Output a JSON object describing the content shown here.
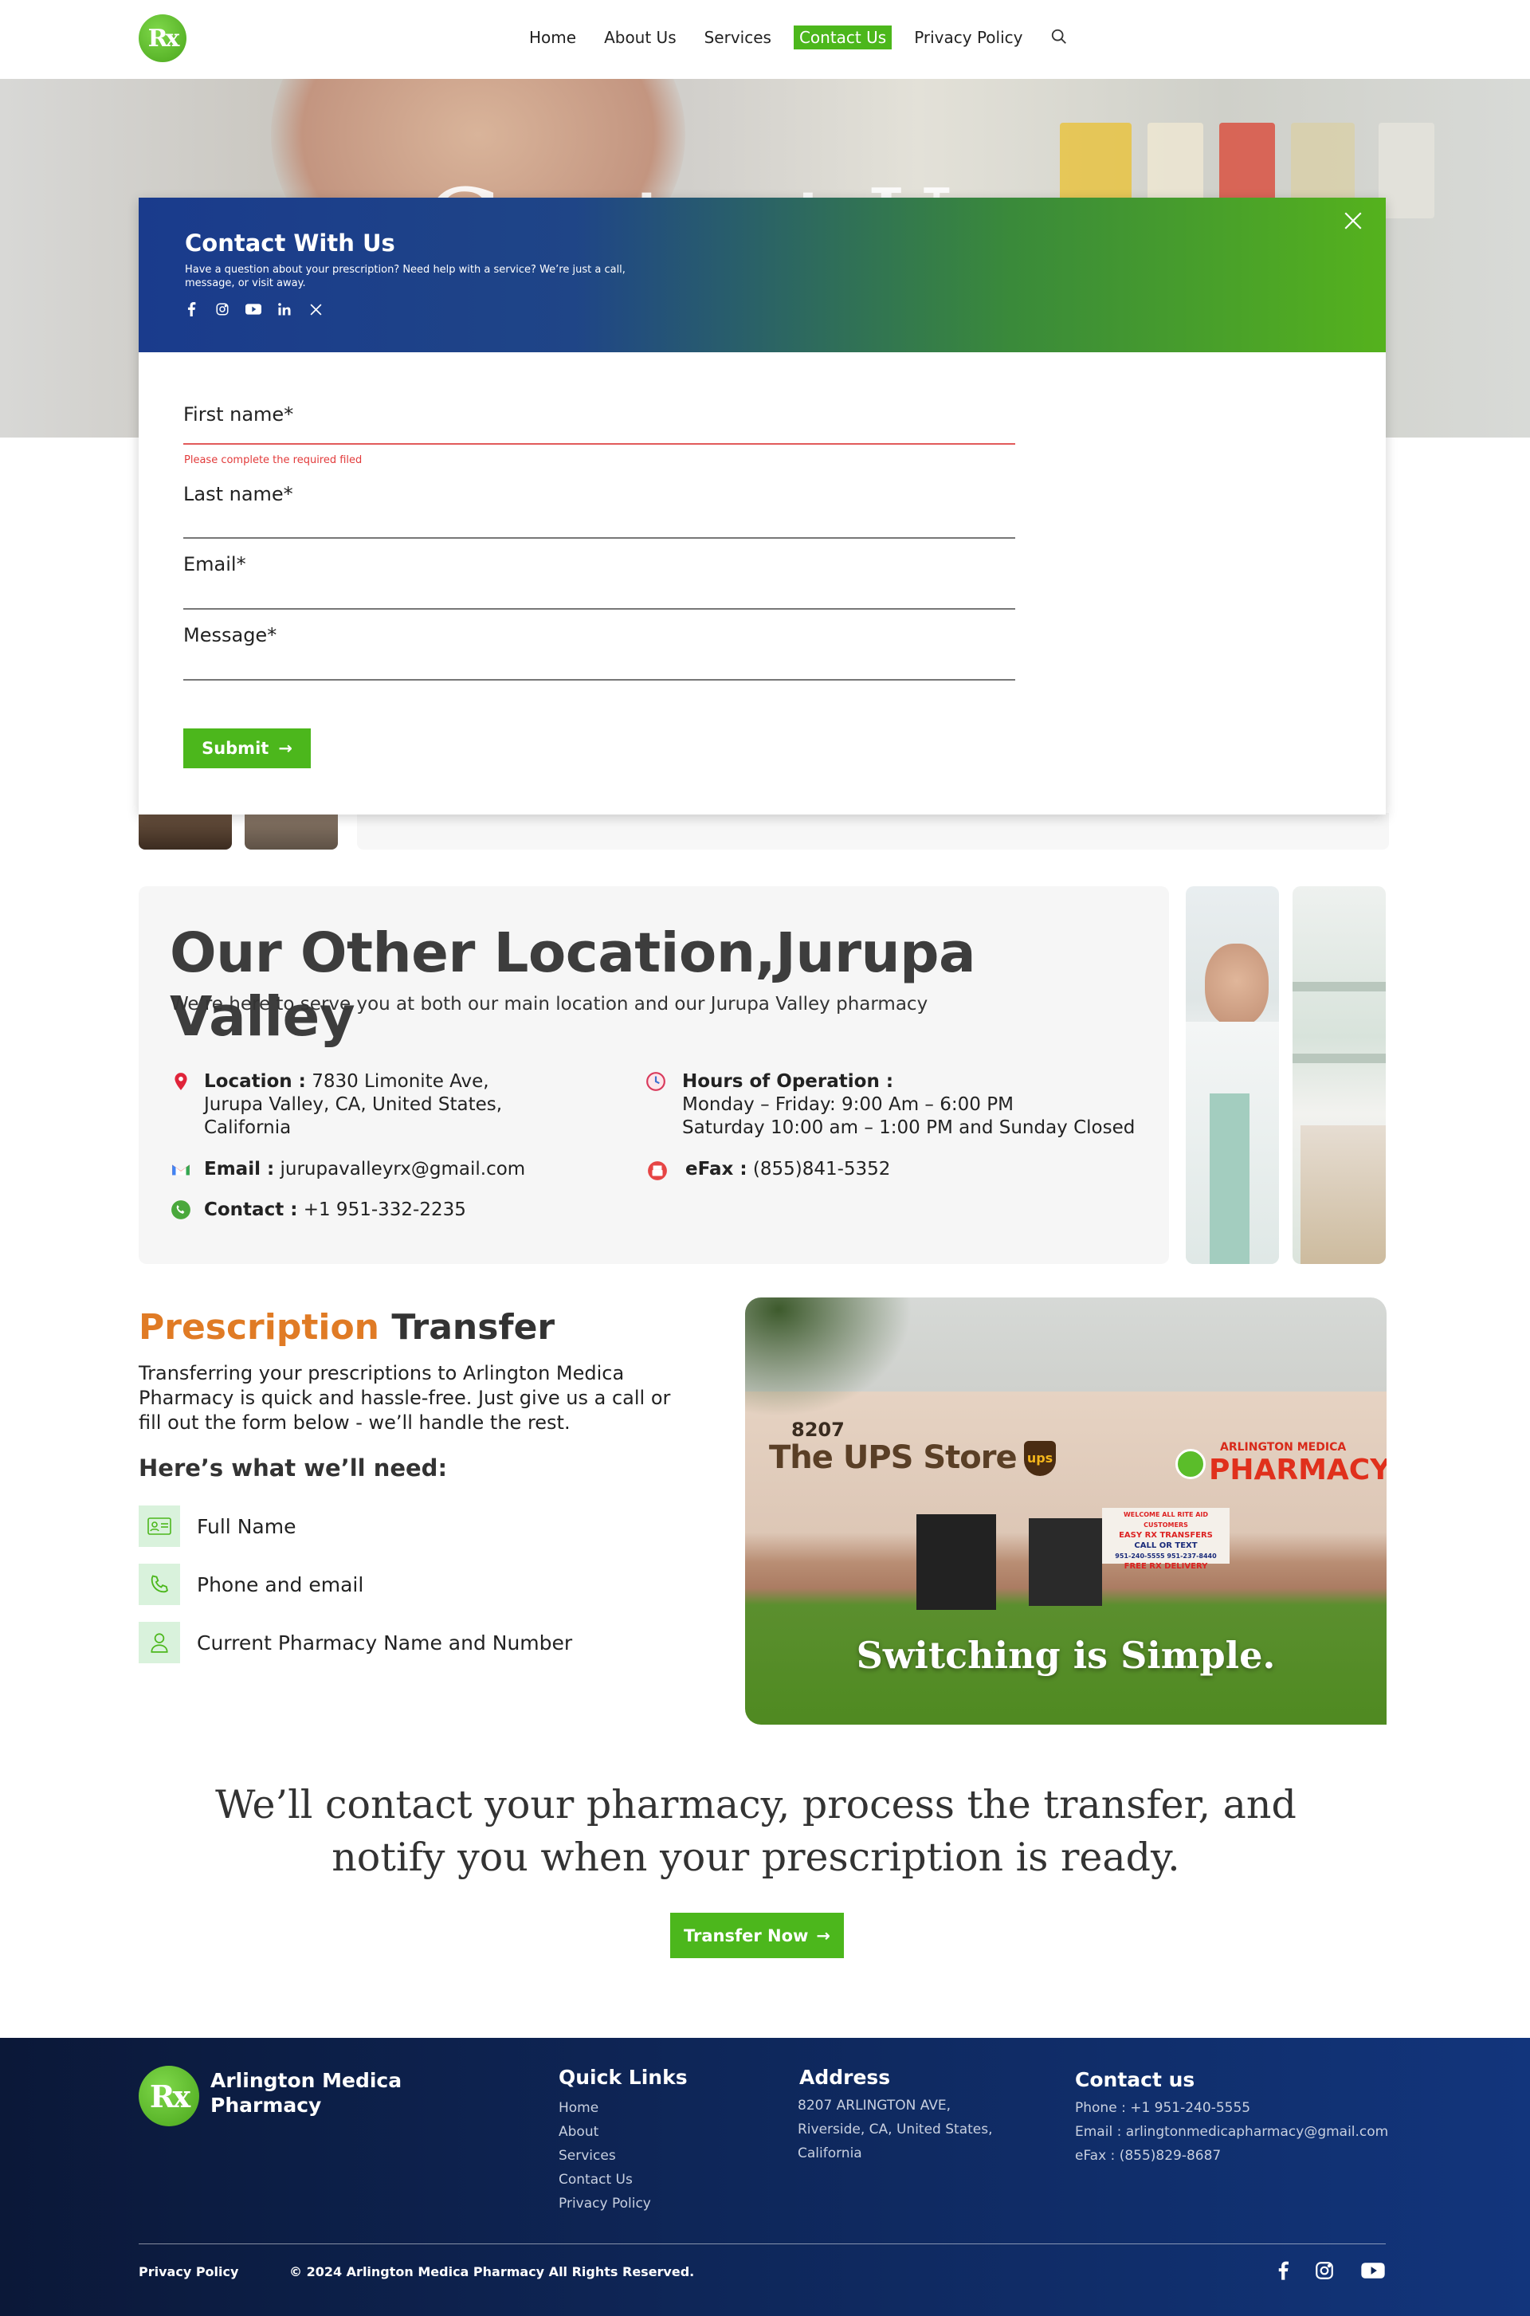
{
  "header": {
    "logo_text": "Rx",
    "nav": [
      {
        "label": "Home"
      },
      {
        "label": "About Us"
      },
      {
        "label": "Services"
      },
      {
        "label": "Contact Us"
      },
      {
        "label": "Privacy Policy"
      }
    ],
    "search_icon": "search-icon"
  },
  "hero": {
    "title": "Contact Us"
  },
  "modal": {
    "title": "Contact With Us",
    "subtitle": "Have a question about your prescription? Need help with a service? We’re just a call, message, or visit away.",
    "social_icons": [
      "facebook-icon",
      "instagram-icon",
      "youtube-icon",
      "linkedin-icon",
      "x-icon"
    ],
    "fields": {
      "first_name": "First name*",
      "last_name": "Last name*",
      "email": "Email*",
      "message": "Message*"
    },
    "error": "Please complete the required filed",
    "submit": "Submit",
    "submit_arrow": "→"
  },
  "location": {
    "title": "Our Other Location,Jurupa Valley",
    "subtitle": "We’re here to serve you at both our main location and our Jurupa Valley pharmacy",
    "address_label": "Location :",
    "address_line1": "7830 Limonite Ave,",
    "address_line2": "Jurupa Valley, CA, United States,",
    "address_line3": "California",
    "hours_label": "Hours of Operation :",
    "hours_line1": "Monday – Friday: 9:00 Am – 6:00 PM",
    "hours_line2": "Saturday 10:00 am – 1:00 PM and Sunday Closed",
    "email_label": "Email :",
    "email_value": "jurupavalleyrx@gmail.com",
    "efax_label": "eFax :",
    "efax_value": "(855)841-5352",
    "contact_label": "Contact :",
    "contact_value": "+1 951-332-2235"
  },
  "transfer": {
    "title_accent": "Prescription",
    "title_rest": "Transfer",
    "body": "Transferring your prescriptions to Arlington Medica Pharmacy is quick and hassle-free. Just give us a call or fill out the form below - we’ll handle the rest.",
    "need_title": "Here’s what we’ll need:",
    "needs": [
      {
        "label": "Full Name",
        "icon": "id-card-icon"
      },
      {
        "label": "Phone and email",
        "icon": "phone-icon"
      },
      {
        "label": "Current Pharmacy Name and Number",
        "icon": "user-icon"
      }
    ],
    "image": {
      "number": "8207",
      "store_sign": "The UPS Store",
      "ups_badge": "ups",
      "pharmacy_small": "ARLINGTON MEDICA",
      "pharmacy_big": "PHARMACY",
      "poster_line1": "WELCOME ALL RITE AID CUSTOMERS",
      "poster_line2": "EASY RX TRANSFERS",
      "poster_line3": "CALL OR TEXT",
      "poster_line4": "951-240-5555 951-237-8440",
      "poster_line5": "FREE RX DELIVERY",
      "caption": "Switching is Simple."
    }
  },
  "cta": {
    "line1": "We’ll contact your pharmacy, process the transfer, and",
    "line2": "notify you when your prescription is ready.",
    "button": "Transfer Now",
    "button_arrow": "→"
  },
  "footer": {
    "brand_line1": "Arlington Medica",
    "brand_line2": "Pharmacy",
    "quick_links_title": "Quick Links",
    "quick_links": [
      "Home",
      "About",
      "Services",
      "Contact Us",
      "Privacy Policy"
    ],
    "address_title": "Address",
    "address_line1": "8207 ARLINGTON AVE,",
    "address_line2": "Riverside, CA, United States,",
    "address_line3": "California",
    "contact_title": "Contact us",
    "phone": "Phone : +1 951-240-5555",
    "email": "Email : arlingtonmedicapharmacy@gmail.com",
    "efax": "eFax : (855)829-8687",
    "privacy": "Privacy Policy",
    "copyright": "© 2024 Arlington Medica Pharmacy All Rights Reserved.",
    "social_icons": [
      "facebook-icon",
      "instagram-icon",
      "youtube-icon"
    ]
  },
  "colors": {
    "brand_green": "#4cb71c",
    "accent_orange": "#e07b25",
    "footer_navy": "#0e2658",
    "error_red": "#e23b3b"
  }
}
